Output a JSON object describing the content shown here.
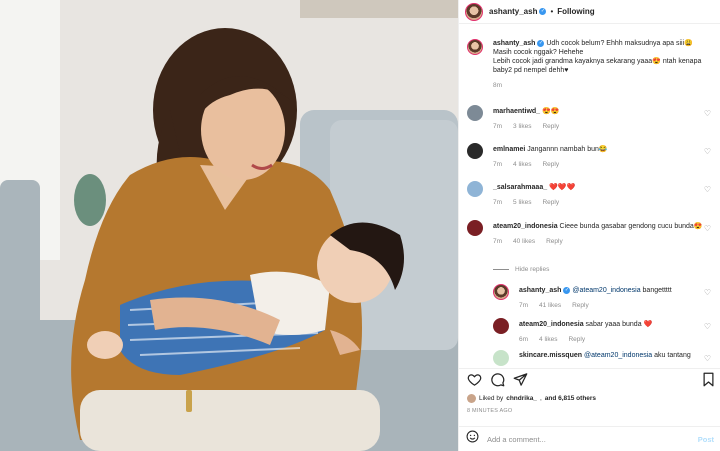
{
  "header": {
    "username": "ashanty_ash",
    "follow_status": "Following"
  },
  "caption": {
    "username": "ashanty_ash",
    "text": "Udh cocok belum? Ehhh maksudnya apa siii😩 Masih cocok nggak? Hehehe\nLebih cocok jadi grandma kayaknya sekarang yaaa😍 ntah kenapa baby2 pd nempel dehh♥",
    "time": "8m"
  },
  "comments": [
    {
      "username": "marhaentiwd_",
      "text": "😍😍",
      "time": "7m",
      "likes": "3 likes",
      "reply": "Reply"
    },
    {
      "username": "emlnamei",
      "text": "Jangannn nambah bun😂",
      "time": "7m",
      "likes": "4 likes",
      "reply": "Reply"
    },
    {
      "username": "_salsarahmaaa_",
      "text": "❤️❤️❤️",
      "time": "7m",
      "likes": "5 likes",
      "reply": "Reply"
    },
    {
      "username": "ateam20_indonesia",
      "text": "Cieee bunda gasabar gendong cucu bunda😍",
      "time": "7m",
      "likes": "40 likes",
      "reply": "Reply"
    }
  ],
  "hide_replies": "Hide replies",
  "replies": [
    {
      "username": "ashanty_ash",
      "mention": "@ateam20_indonesia",
      "text": " bangettttt",
      "time": "7m",
      "likes": "41 likes",
      "reply": "Reply"
    },
    {
      "username": "ateam20_indonesia",
      "mention": "",
      "text": "sabar yaaa bunda ❤️",
      "time": "6m",
      "likes": "4 likes",
      "reply": "Reply"
    },
    {
      "username": "skincare.missquen",
      "mention": "@ateam20_indonesia",
      "text": " aku tantang",
      "time": "",
      "likes": "",
      "reply": ""
    }
  ],
  "actions": {
    "liked_by_prefix": "Liked by",
    "liked_by_user": "chndrika_",
    "liked_by_suffix": "and 6,815 others",
    "timestamp": "8 MINUTES AGO"
  },
  "add_comment": {
    "placeholder": "Add a comment...",
    "post_label": "Post"
  },
  "icons": [
    "heart-icon",
    "comment-icon",
    "share-icon",
    "bookmark-icon",
    "emoji-icon",
    "verified-icon"
  ],
  "colors": {
    "accent": "#3897f0",
    "post_disabled": "#b2dffc",
    "muted": "#8e8e8e"
  }
}
